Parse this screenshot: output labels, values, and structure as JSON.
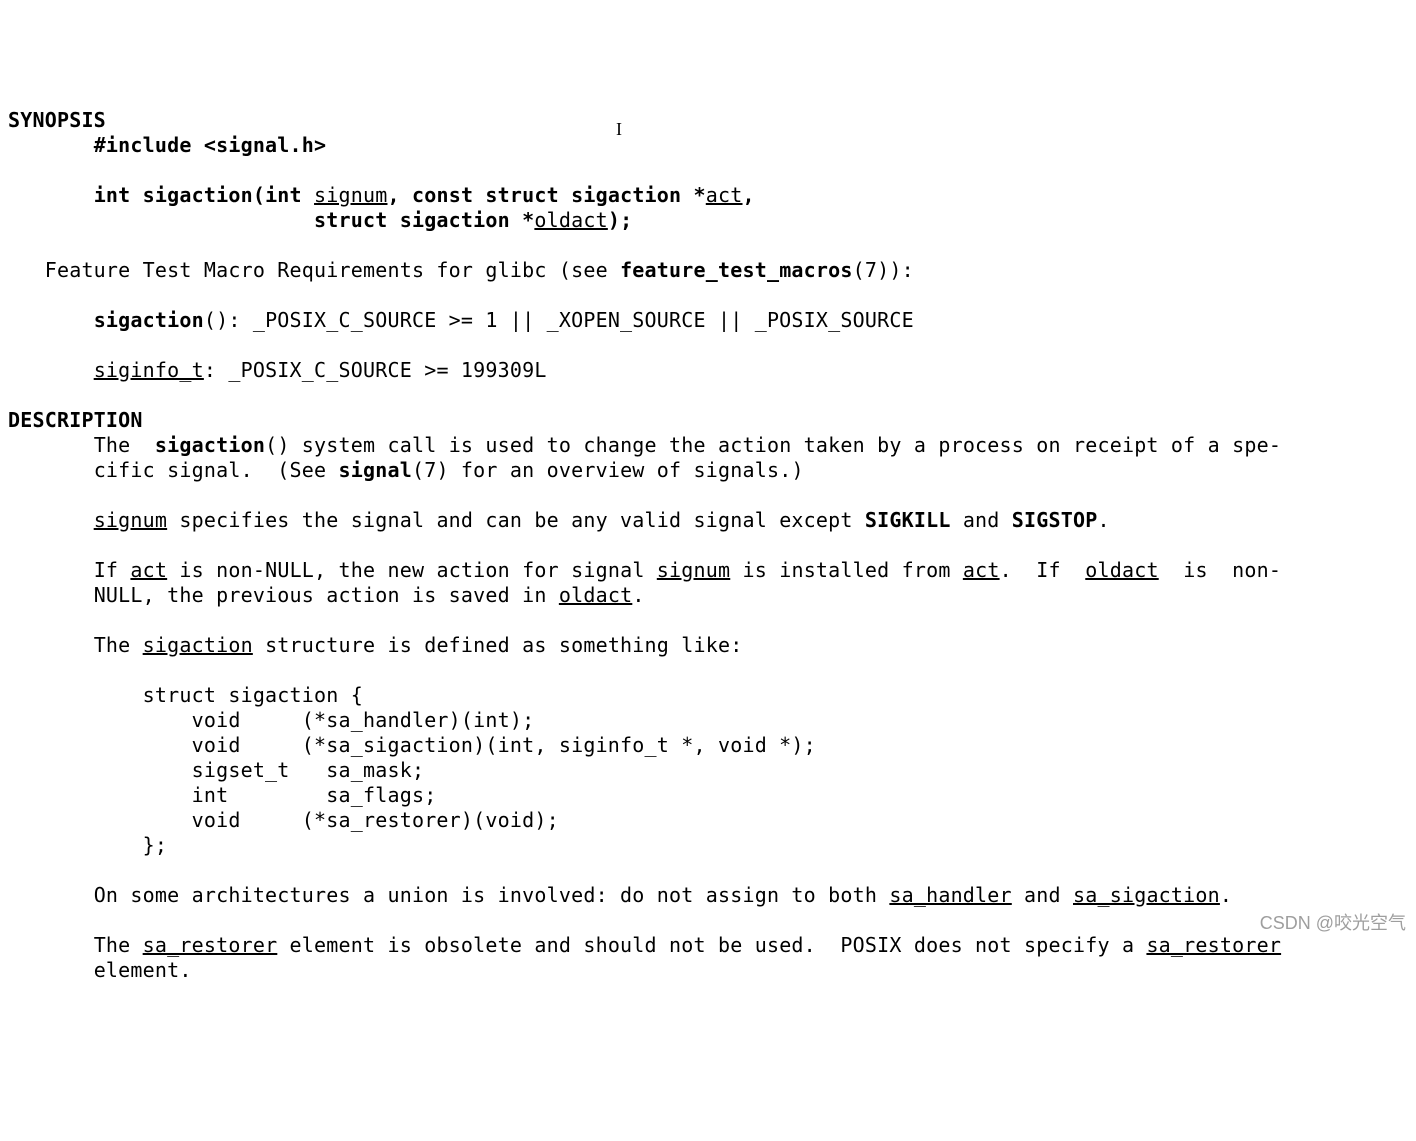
{
  "headings": {
    "synopsis": "SYNOPSIS",
    "description": "DESCRIPTION"
  },
  "synopsis": {
    "include": "#include <signal.h>",
    "decl_int": "int ",
    "decl_fn": "sigaction",
    "decl_open": "(int ",
    "arg_signum": "signum",
    "decl_after_signum": ", const struct sigaction *",
    "arg_act": "act",
    "decl_after_act": ",",
    "decl_line2_prefix": "                  struct sigaction *",
    "arg_oldact": "oldact",
    "decl_close": ");"
  },
  "ftm": {
    "line_pre": "   Feature Test Macro Requirements for glibc (see ",
    "ftm_ref": "feature_test_macros",
    "ftm_suffix": "(7)):",
    "sigaction_fn": "sigaction",
    "sigaction_cond": "(): _POSIX_C_SOURCE >= 1 || _XOPEN_SOURCE || _POSIX_SOURCE",
    "siginfo_t": "siginfo_t",
    "siginfo_cond": ": _POSIX_C_SOURCE >= 199309L"
  },
  "desc": {
    "p1_a": "The  ",
    "p1_fn": "sigaction",
    "p1_b": "() system call is used to change the action taken by a process on receipt of a spe-",
    "p1_c": "cific signal.  (See ",
    "p1_sigref": "signal",
    "p1_d": "(7) for an overview of signals.)",
    "p2_signum": "signum",
    "p2_a": " specifies the signal and can be any valid signal except ",
    "p2_sigkill": "SIGKILL",
    "p2_and": " and ",
    "p2_sigstop": "SIGSTOP",
    "p2_end": ".",
    "p3_a": "If ",
    "p3_act": "act",
    "p3_b": " is non-NULL, the new action for signal ",
    "p3_signum": "signum",
    "p3_c": " is installed from ",
    "p3_act2": "act",
    "p3_d": ".  If  ",
    "p3_oldact": "oldact",
    "p3_e": "  is  non-",
    "p3_f": "NULL, the previous action is saved in ",
    "p3_oldact2": "oldact",
    "p3_g": ".",
    "p4_a": "The ",
    "p4_sigaction": "sigaction",
    "p4_b": " structure is defined as something like:",
    "struct": {
      "l1": "    struct sigaction {",
      "l2": "        void     (*sa_handler)(int);",
      "l3": "        void     (*sa_sigaction)(int, siginfo_t *, void *);",
      "l4": "        sigset_t   sa_mask;",
      "l5": "        int        sa_flags;",
      "l6": "        void     (*sa_restorer)(void);",
      "l7": "    };"
    },
    "p5_a": "On some architectures a union is involved: do not assign to both ",
    "p5_sah": "sa_handler",
    "p5_and": " and ",
    "p5_sas": "sa_sigaction",
    "p5_end": ".",
    "p6_a": "The ",
    "p6_sar": "sa_restorer",
    "p6_b": " element is obsolete and should not be used.  POSIX does not specify a ",
    "p6_sar2": "sa_restorer",
    "p6_c": "element."
  },
  "cursor": "I",
  "watermark": "CSDN @咬光空气"
}
